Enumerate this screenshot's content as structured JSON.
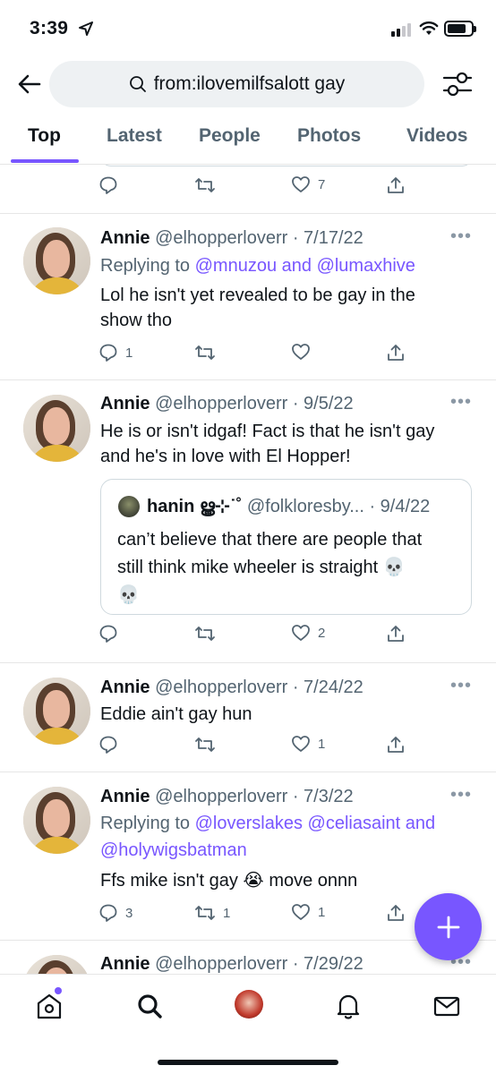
{
  "status_bar": {
    "time": "3:39",
    "location_icon": "location-arrow-icon",
    "signal_icon": "cellular-signal-icon",
    "wifi_icon": "wifi-icon",
    "battery_icon": "battery-icon"
  },
  "search": {
    "back_icon": "back-arrow-icon",
    "query": "from:ilovemilfsalott gay",
    "search_icon": "search-icon",
    "filter_icon": "filter-sliders-icon"
  },
  "tabs": [
    {
      "label": "Top",
      "active": true
    },
    {
      "label": "Latest",
      "active": false
    },
    {
      "label": "People",
      "active": false
    },
    {
      "label": "Photos",
      "active": false
    },
    {
      "label": "Videos",
      "active": false
    }
  ],
  "partial_tweet": {
    "like_count": "7"
  },
  "tweets": [
    {
      "name": "Annie",
      "meta": "@elhopperloverr · 7/17/22",
      "replying_prefix": "Replying to ",
      "replying_mentions": "@mnuzou and @lumaxhive",
      "text_lines": [
        "Lol he isn't yet revealed to be gay in the",
        "show tho"
      ],
      "reply_count": "1",
      "retweet_count": "",
      "like_count": ""
    },
    {
      "name": "Annie",
      "meta": "@elhopperloverr · 9/5/22",
      "text_lines": [
        "He is or isn't idgaf! Fact is that he isn't gay",
        "and he's in love with El Hopper!"
      ],
      "quote": {
        "name": "hanin ൠ⊹˙˚",
        "meta": "@folkloresby... · 9/4/22",
        "text_lines": [
          "can’t believe that there are people that",
          "still think mike wheeler is straight 💀",
          "💀"
        ]
      },
      "reply_count": "",
      "retweet_count": "",
      "like_count": "2"
    },
    {
      "name": "Annie",
      "meta": "@elhopperloverr · 7/24/22",
      "text_lines": [
        "Eddie ain't gay hun"
      ],
      "reply_count": "",
      "retweet_count": "",
      "like_count": "1"
    },
    {
      "name": "Annie",
      "meta": "@elhopperloverr · 7/3/22",
      "replying_prefix": "Replying to ",
      "replying_mentions_line1": "@loverslakes @celiasaint and",
      "replying_mentions_line2": "@holywigsbatman",
      "text_lines": [
        "Ffs mike isn't gay 😭 move onnn"
      ],
      "reply_count": "3",
      "retweet_count": "1",
      "like_count": "1"
    },
    {
      "name": "Annie",
      "meta": "@elhopperloverr · 7/29/22"
    }
  ],
  "more_label": "•••",
  "compose_icon": "plus-icon",
  "bottom_nav": [
    {
      "icon": "home-icon",
      "has_badge": true
    },
    {
      "icon": "search-icon"
    },
    {
      "icon": "profile-avatar"
    },
    {
      "icon": "notifications-bell-icon"
    },
    {
      "icon": "messages-envelope-icon"
    }
  ]
}
